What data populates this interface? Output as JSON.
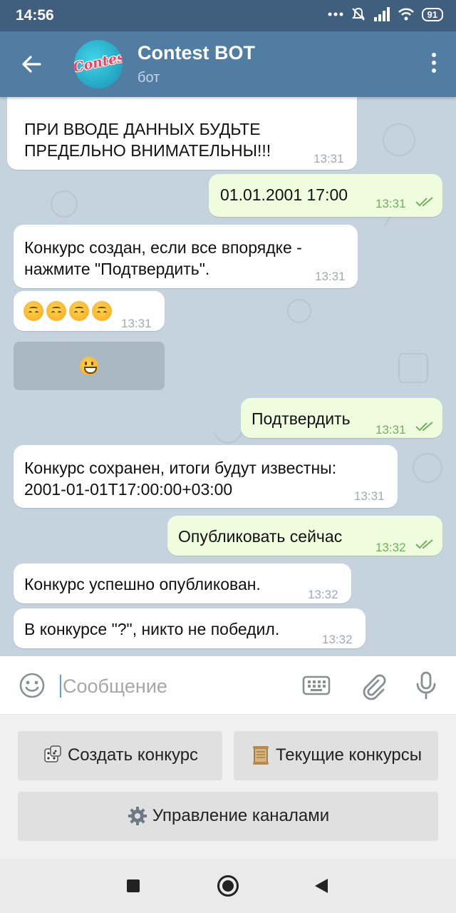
{
  "status_bar": {
    "time": "14:56",
    "battery": "91"
  },
  "header": {
    "title": "Contest BOT",
    "subtitle": "бот",
    "avatar_text": "Contest"
  },
  "messages": [
    {
      "direction": "in",
      "text_line1": "ПРИ ВВОДЕ ДАННЫХ БУДЬТЕ",
      "text_line2": "ПРЕДЕЛЬНО ВНИМАТЕЛЬНЫ!!!",
      "time": "13:31"
    },
    {
      "direction": "out",
      "text": "01.01.2001 17:00",
      "time": "13:31"
    },
    {
      "direction": "in",
      "text_line1": "Конкурс создан, если все впорядке -",
      "text_line2": "нажмите \"Подтвердить\".",
      "time": "13:31"
    },
    {
      "direction": "in",
      "text": "🙃🙃🙃🙃",
      "time": "13:31"
    },
    {
      "direction": "out",
      "text": "Подтвердить",
      "time": "13:31"
    },
    {
      "direction": "in",
      "text_line1": "Конкурс сохранен, итоги будут известны:",
      "text_line2": "2001-01-01T17:00:00+03:00",
      "time": "13:31"
    },
    {
      "direction": "out",
      "text": "Опубликовать сейчас",
      "time": "13:32"
    },
    {
      "direction": "in",
      "text": "Конкурс успешно опубликован.",
      "time": "13:32"
    },
    {
      "direction": "in",
      "text": "В конкурсе \"?\", никто не победил.",
      "time": "13:32"
    }
  ],
  "inline_button": {
    "emoji": "😀"
  },
  "composer": {
    "placeholder": "Сообщение"
  },
  "keyboard": {
    "create": "Создать конкурс",
    "current": "Текущие конкурсы",
    "channels": "Управление каналами"
  },
  "colors": {
    "header": "#517da2",
    "statusbar": "#405f7e",
    "chat_bg": "#c5d3de",
    "out_bubble": "#effdde",
    "in_bubble": "#ffffff"
  }
}
